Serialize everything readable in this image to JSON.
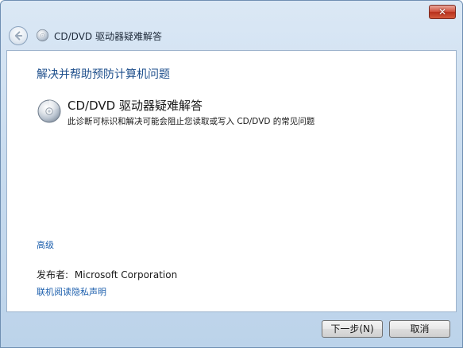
{
  "window": {
    "title": "CD/DVD 驱动器疑难解答"
  },
  "main": {
    "heading": "解决并帮助预防计算机问题",
    "item": {
      "title": "CD/DVD 驱动器疑难解答",
      "description": "此诊断可标识和解决可能会阻止您读取或写入 CD/DVD 的常见问题",
      "icon": "cd-disc-icon"
    },
    "advanced_link": "高级",
    "publisher_label": "发布者:",
    "publisher_value": "Microsoft Corporation",
    "privacy_link": "联机阅读隐私声明"
  },
  "footer": {
    "next_label": "下一步(N)",
    "cancel_label": "取消"
  },
  "colors": {
    "heading": "#1e4f8c",
    "link": "#1c5fad",
    "close_button": "#c7432a"
  }
}
